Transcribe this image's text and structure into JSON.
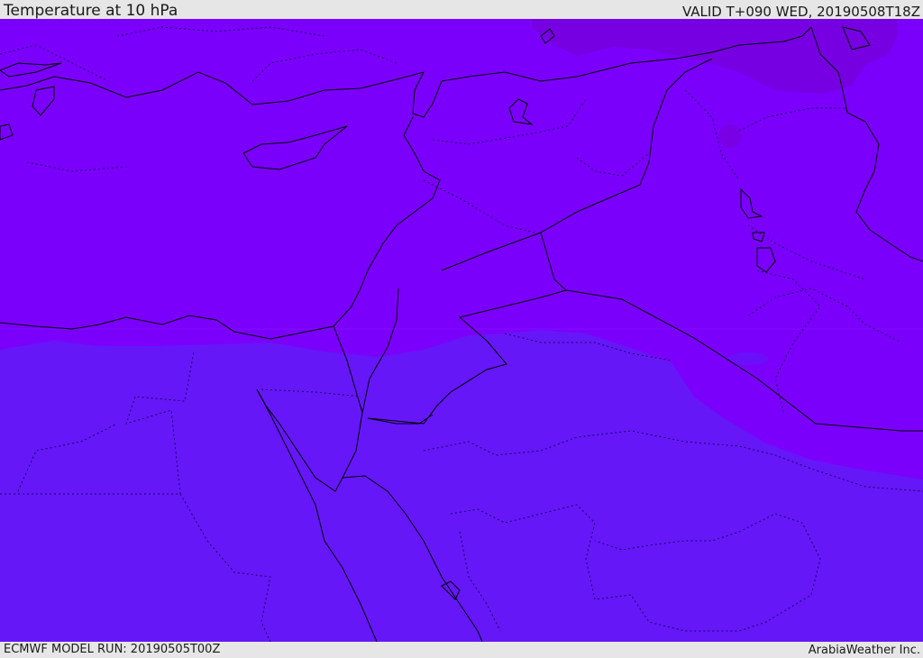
{
  "header": {
    "title": "Temperature at 10 hPa",
    "valid": "VALID T+090 WED, 20190508T18Z"
  },
  "footer": {
    "model_run": "ECMWF MODEL RUN: 20190505T00Z",
    "credit": "ArabiaWeather Inc."
  },
  "colors": {
    "warm_band": "#7b00fb",
    "cool_band": "#6517f8",
    "warmest_patch": "#7600e2",
    "coastline": "#000000",
    "chrome_background": "#e6e6e6"
  }
}
